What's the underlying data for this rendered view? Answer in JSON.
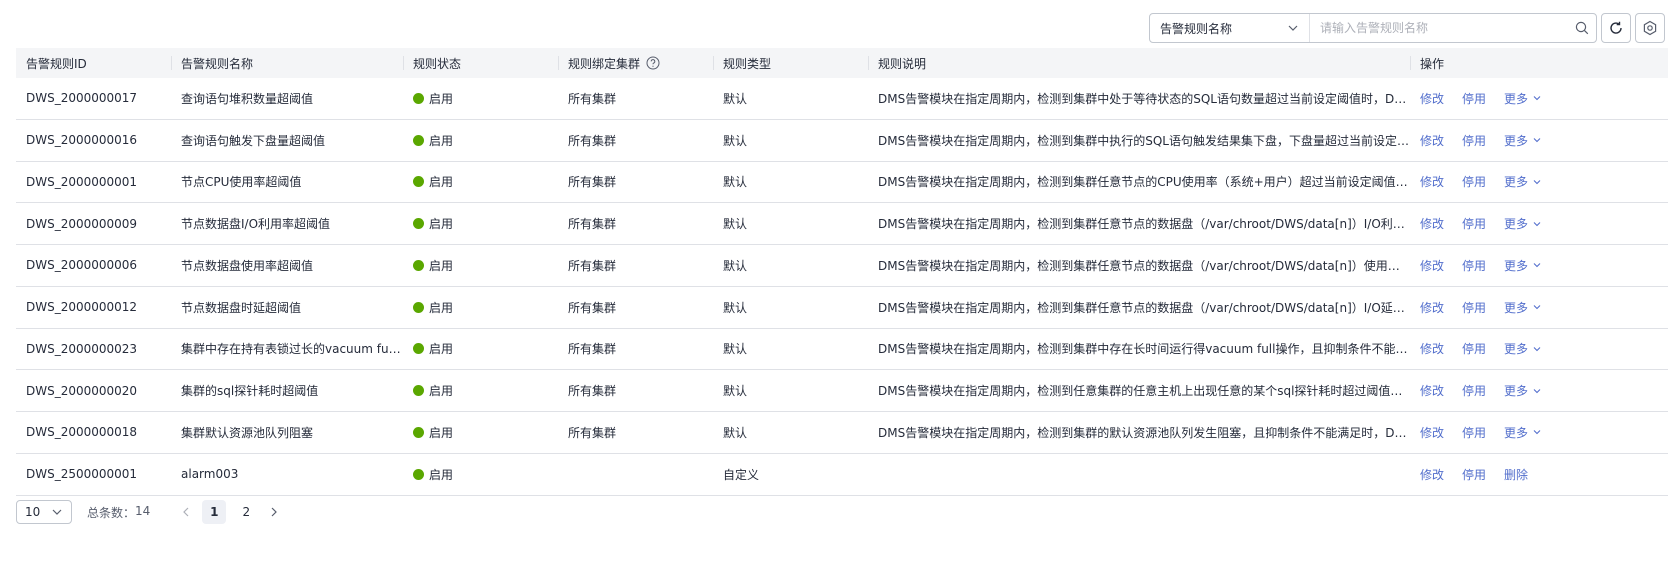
{
  "toolbar": {
    "filter_label": "告警规则名称",
    "search_placeholder": "请输入告警规则名称"
  },
  "columns": {
    "id": "告警规则ID",
    "name": "告警规则名称",
    "status": "规则状态",
    "cluster": "规则绑定集群",
    "type": "规则类型",
    "desc": "规则说明",
    "ops": "操作"
  },
  "rows": [
    {
      "id": "DWS_2000000017",
      "name": "查询语句堆积数量超阈值",
      "status": "启用",
      "cluster": "所有集群",
      "type": "默认",
      "desc": "DMS告警模块在指定周期内，检测到集群中处于等待状态的SQL语句数量超过当前设定阈值时，DMS...",
      "op1": "修改",
      "op2": "停用",
      "op3": "更多"
    },
    {
      "id": "DWS_2000000016",
      "name": "查询语句触发下盘量超阈值",
      "status": "启用",
      "cluster": "所有集群",
      "type": "默认",
      "desc": "DMS告警模块在指定周期内，检测到集群中执行的SQL语句触发结果集下盘，下盘量超过当前设定阈值...",
      "op1": "修改",
      "op2": "停用",
      "op3": "更多"
    },
    {
      "id": "DWS_2000000001",
      "name": "节点CPU使用率超阈值",
      "status": "启用",
      "cluster": "所有集群",
      "type": "默认",
      "desc": "DMS告警模块在指定周期内，检测到集群任意节点的CPU使用率（系统+用户）超过当前设定阈值，且...",
      "op1": "修改",
      "op2": "停用",
      "op3": "更多"
    },
    {
      "id": "DWS_2000000009",
      "name": "节点数据盘I/O利用率超阈值",
      "status": "启用",
      "cluster": "所有集群",
      "type": "默认",
      "desc": "DMS告警模块在指定周期内，检测到集群任意节点的数据盘（/var/chroot/DWS/data[n]）I/O利用率（uti...",
      "op1": "修改",
      "op2": "停用",
      "op3": "更多"
    },
    {
      "id": "DWS_2000000006",
      "name": "节点数据盘使用率超阈值",
      "status": "启用",
      "cluster": "所有集群",
      "type": "默认",
      "desc": "DMS告警模块在指定周期内，检测到集群任意节点的数据盘（/var/chroot/DWS/data[n]）使用率超过当...",
      "op1": "修改",
      "op2": "停用",
      "op3": "更多"
    },
    {
      "id": "DWS_2000000012",
      "name": "节点数据盘时延超阈值",
      "status": "启用",
      "cluster": "所有集群",
      "type": "默认",
      "desc": "DMS告警模块在指定周期内，检测到集群任意节点的数据盘（/var/chroot/DWS/data[n]）I/O延时（awai...",
      "op1": "修改",
      "op2": "停用",
      "op3": "更多"
    },
    {
      "id": "DWS_2000000023",
      "name": "集群中存在持有表锁过长的vacuum full...",
      "status": "启用",
      "cluster": "所有集群",
      "type": "默认",
      "desc": "DMS告警模块在指定周期内，检测到集群中存在长时间运行得vacuum full操作，且抑制条件不能满足时...",
      "op1": "修改",
      "op2": "停用",
      "op3": "更多"
    },
    {
      "id": "DWS_2000000020",
      "name": "集群的sql探针耗时超阈值",
      "status": "启用",
      "cluster": "所有集群",
      "type": "默认",
      "desc": "DMS告警模块在指定周期内，检测到任意集群的任意主机上出现任意的某个sql探针耗时超过阈值，且...",
      "op1": "修改",
      "op2": "停用",
      "op3": "更多"
    },
    {
      "id": "DWS_2000000018",
      "name": "集群默认资源池队列阻塞",
      "status": "启用",
      "cluster": "所有集群",
      "type": "默认",
      "desc": "DMS告警模块在指定周期内，检测到集群的默认资源池队列发生阻塞，且抑制条件不能满足时，DMS...",
      "op1": "修改",
      "op2": "停用",
      "op3": "更多"
    },
    {
      "id": "DWS_2500000001",
      "name": "alarm003",
      "status": "启用",
      "cluster": "",
      "type": "自定义",
      "desc": "",
      "op1": "修改",
      "op2": "停用",
      "op3": "删除"
    }
  ],
  "pagination": {
    "page_size": "10",
    "total_label": "总条数：",
    "total_value": "14",
    "pages": [
      "1",
      "2"
    ],
    "current": "1"
  },
  "colors": {
    "link": "#526ecc",
    "status_enabled": "#5aa700",
    "header_bg": "#f4f5f7"
  },
  "icons": [
    "chevron-down-icon",
    "search-icon",
    "refresh-icon",
    "settings-icon",
    "help-icon",
    "chevron-left-icon",
    "chevron-right-icon"
  ]
}
